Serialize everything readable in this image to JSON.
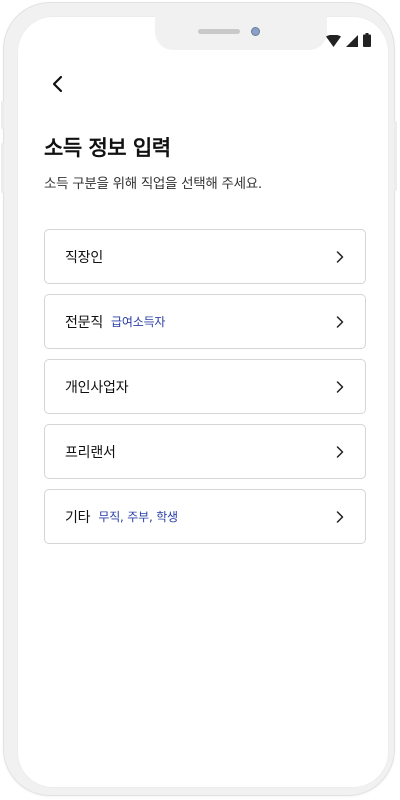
{
  "header": {
    "back_icon": "back-arrow-icon"
  },
  "page": {
    "title": "소득 정보 입력",
    "description": "소득 구분을 위해 직업을 선택해 주세요."
  },
  "jobs": [
    {
      "label": "직장인",
      "sub": ""
    },
    {
      "label": "전문직",
      "sub": "급여소득자"
    },
    {
      "label": "개인사업자",
      "sub": ""
    },
    {
      "label": "프리랜서",
      "sub": ""
    },
    {
      "label": "기타",
      "sub": "무직, 주부, 학생"
    }
  ],
  "status_bar": {
    "icons": [
      "wifi-icon",
      "cellular-signal-icon",
      "battery-icon"
    ]
  },
  "colors": {
    "accent_sub": "#2a3fa8",
    "border": "#d5d5d5",
    "text": "#111111"
  }
}
